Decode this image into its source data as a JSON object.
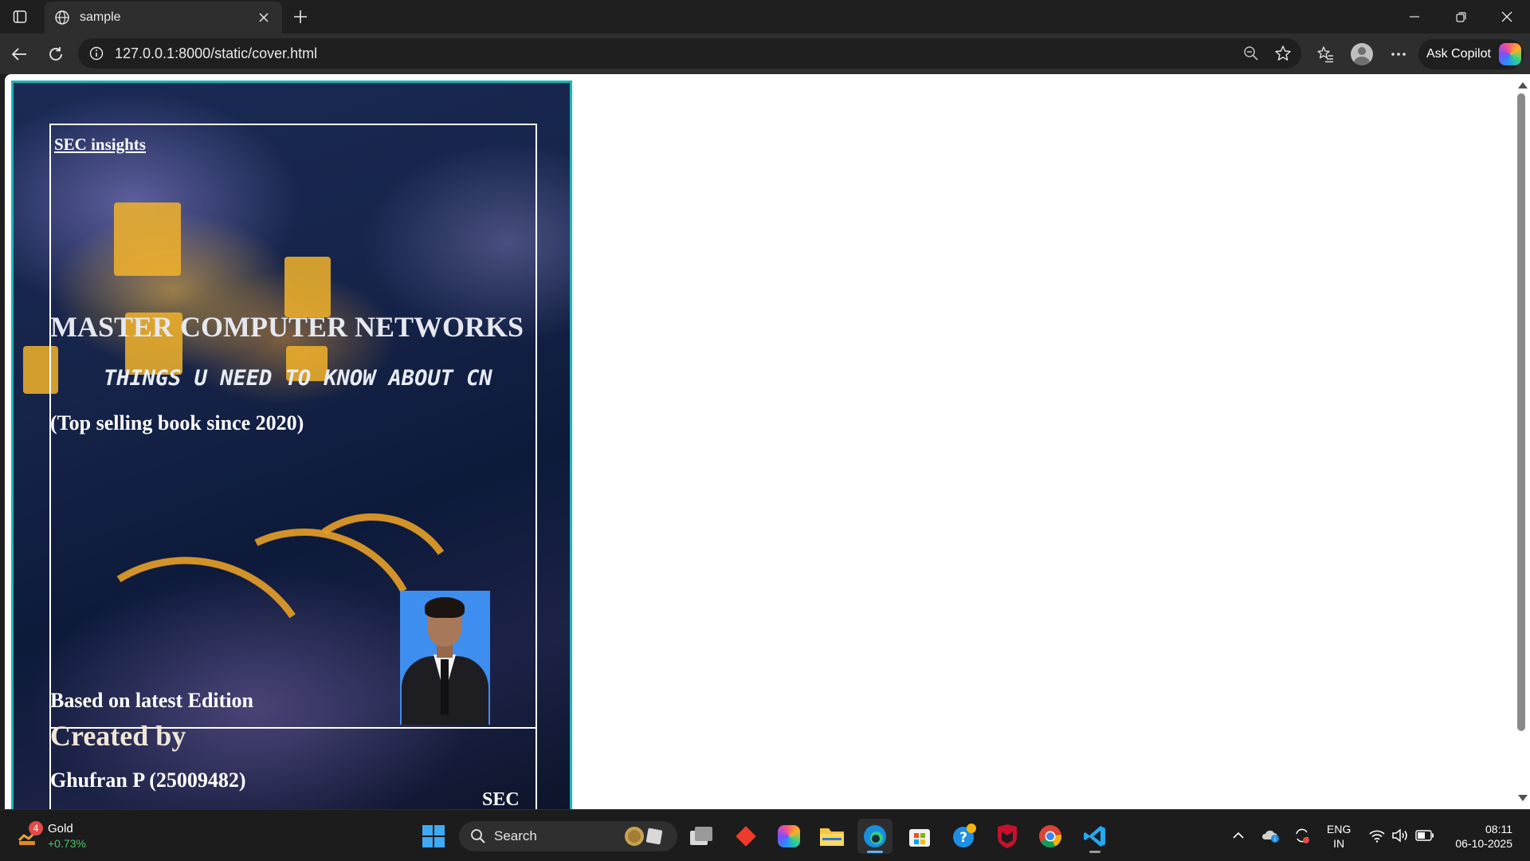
{
  "browser": {
    "tab_title": "sample",
    "url": "127.0.0.1:8000/static/cover.html",
    "copilot_label": "Ask Copilot"
  },
  "cover": {
    "brand": "SEC insights",
    "title": "MASTER COMPUTER NETWORKS",
    "subtitle": "THINGS U NEED TO KNOW ABOUT CN",
    "tagline": "(Top selling book since 2020)",
    "based_on": "Based on latest Edition",
    "created_by": "Created by",
    "author": "Ghufran P (25009482)",
    "stamp": "SEC",
    "border_color": "#17b8b8"
  },
  "taskbar": {
    "widget_name": "Gold",
    "widget_change": "+0.73%",
    "widget_badge": "4",
    "search_label": "Search",
    "lang_line1": "ENG",
    "lang_line2": "IN",
    "time": "08:11",
    "date": "06-10-2025"
  },
  "icons": [
    "sidebar-icon",
    "globe-icon",
    "close-icon",
    "plus-icon",
    "minimize-icon",
    "restore-icon",
    "window-close-icon",
    "back-icon",
    "refresh-icon",
    "info-icon",
    "zoom-out-icon",
    "star-icon",
    "favorites-icon",
    "profile-icon",
    "more-icon",
    "copilot-icon",
    "windows-start-icon",
    "search-icon",
    "task-view-icon",
    "anydesk-icon",
    "copilot-app-icon",
    "file-explorer-icon",
    "edge-icon",
    "store-icon",
    "help-icon",
    "mcafee-icon",
    "chrome-icon",
    "vscode-icon",
    "chevron-up-icon",
    "onedrive-icon",
    "sync-icon",
    "wifi-icon",
    "volume-icon",
    "battery-icon"
  ]
}
